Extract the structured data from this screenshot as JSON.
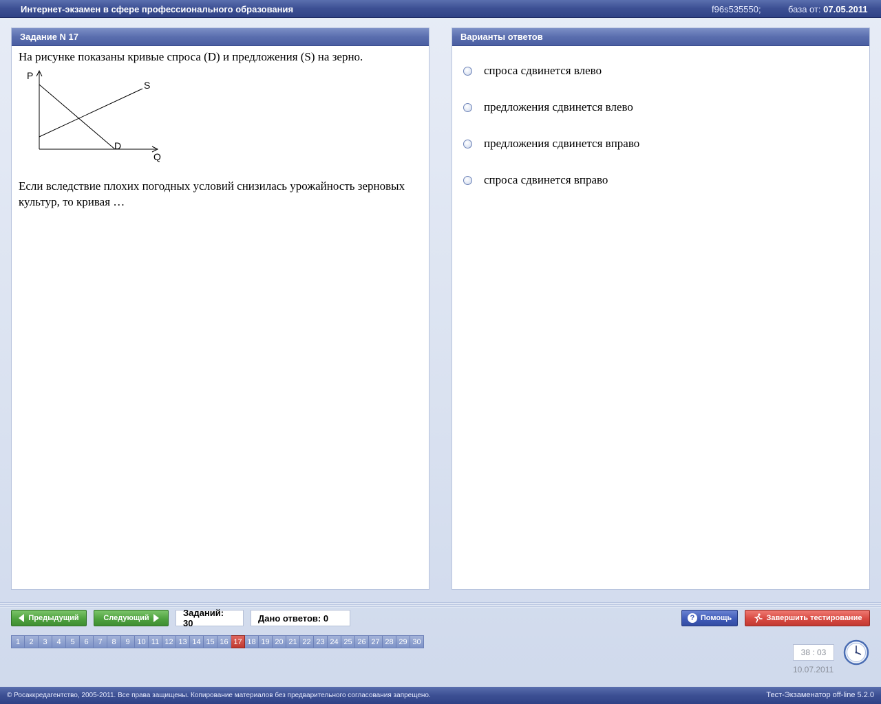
{
  "titlebar": {
    "title": "Интернет-экзамен в сфере профессионального образования",
    "session": "f96s535550;",
    "base_label": "база от:",
    "base_date": "07.05.2011"
  },
  "question": {
    "header": "Задание N 17",
    "text1": "На рисунке показаны кривые спроса (D) и предложения (S) на зерно.",
    "graph": {
      "p_label": "P",
      "q_label": "Q",
      "s_label": "S",
      "d_label": "D"
    },
    "text2": "Если вследствие плохих погодных условий снизилась урожайность зерновых культур, то кривая …"
  },
  "answers": {
    "header": "Варианты ответов",
    "options": [
      "спроса сдвинется влево",
      "предложения сдвинется влево",
      "предложения сдвинется вправо",
      "спроса сдвинется вправо"
    ]
  },
  "toolbar": {
    "prev": "Предыдущий",
    "next": "Следующий",
    "tasks_count": "Заданий: 30",
    "answers_given": "Дано ответов: 0",
    "help": "Помощь",
    "finish": "Завершить тестирование"
  },
  "pager": {
    "pages": [
      "1",
      "2",
      "3",
      "4",
      "5",
      "6",
      "7",
      "8",
      "9",
      "10",
      "11",
      "12",
      "13",
      "14",
      "15",
      "16",
      "17",
      "18",
      "19",
      "20",
      "21",
      "22",
      "23",
      "24",
      "25",
      "26",
      "27",
      "28",
      "29",
      "30"
    ],
    "active": "17"
  },
  "timer": {
    "time": "38 : 03",
    "date": "10.07.2011"
  },
  "footer": {
    "copyright": "© Росаккредагентство, 2005-2011. Все права защищены. Копирование материалов без предварительного согласования запрещено.",
    "version": "Тест-Экзаменатор off-line 5.2.0"
  }
}
